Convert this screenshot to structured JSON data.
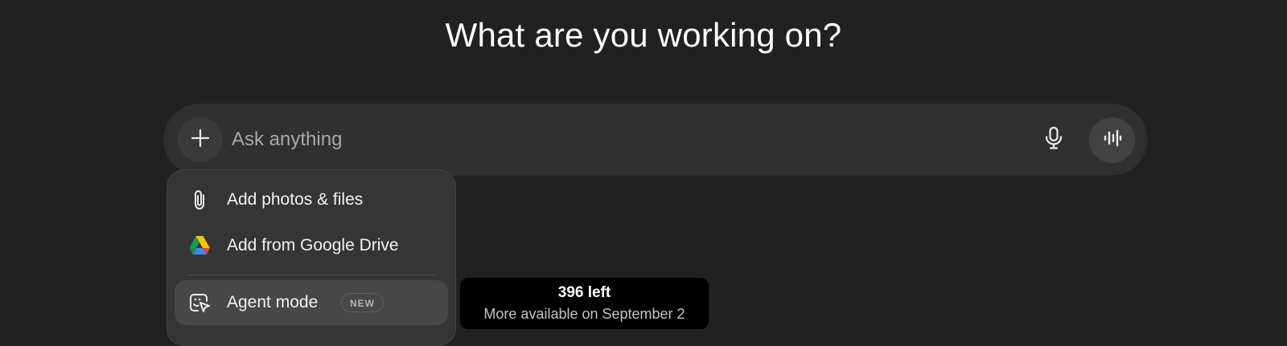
{
  "heading": "What are you working on?",
  "composer": {
    "placeholder": "Ask anything",
    "value": "",
    "plus_icon": "plus-icon",
    "mic_icon": "microphone-icon",
    "voice_icon": "voice-waveform-icon"
  },
  "menu": {
    "items": [
      {
        "label": "Add photos & files",
        "icon": "paperclip-icon"
      },
      {
        "label": "Add from Google Drive",
        "icon": "google-drive-icon"
      },
      {
        "label": "Agent mode",
        "icon": "agent-cursor-icon",
        "badge": "NEW"
      }
    ]
  },
  "tooltip": {
    "title": "396 left",
    "subtitle": "More available on September 2"
  },
  "colors": {
    "background": "#212121",
    "composer": "#303030",
    "menu": "#353535",
    "menu_highlight": "#474747",
    "tooltip": "#000000"
  }
}
